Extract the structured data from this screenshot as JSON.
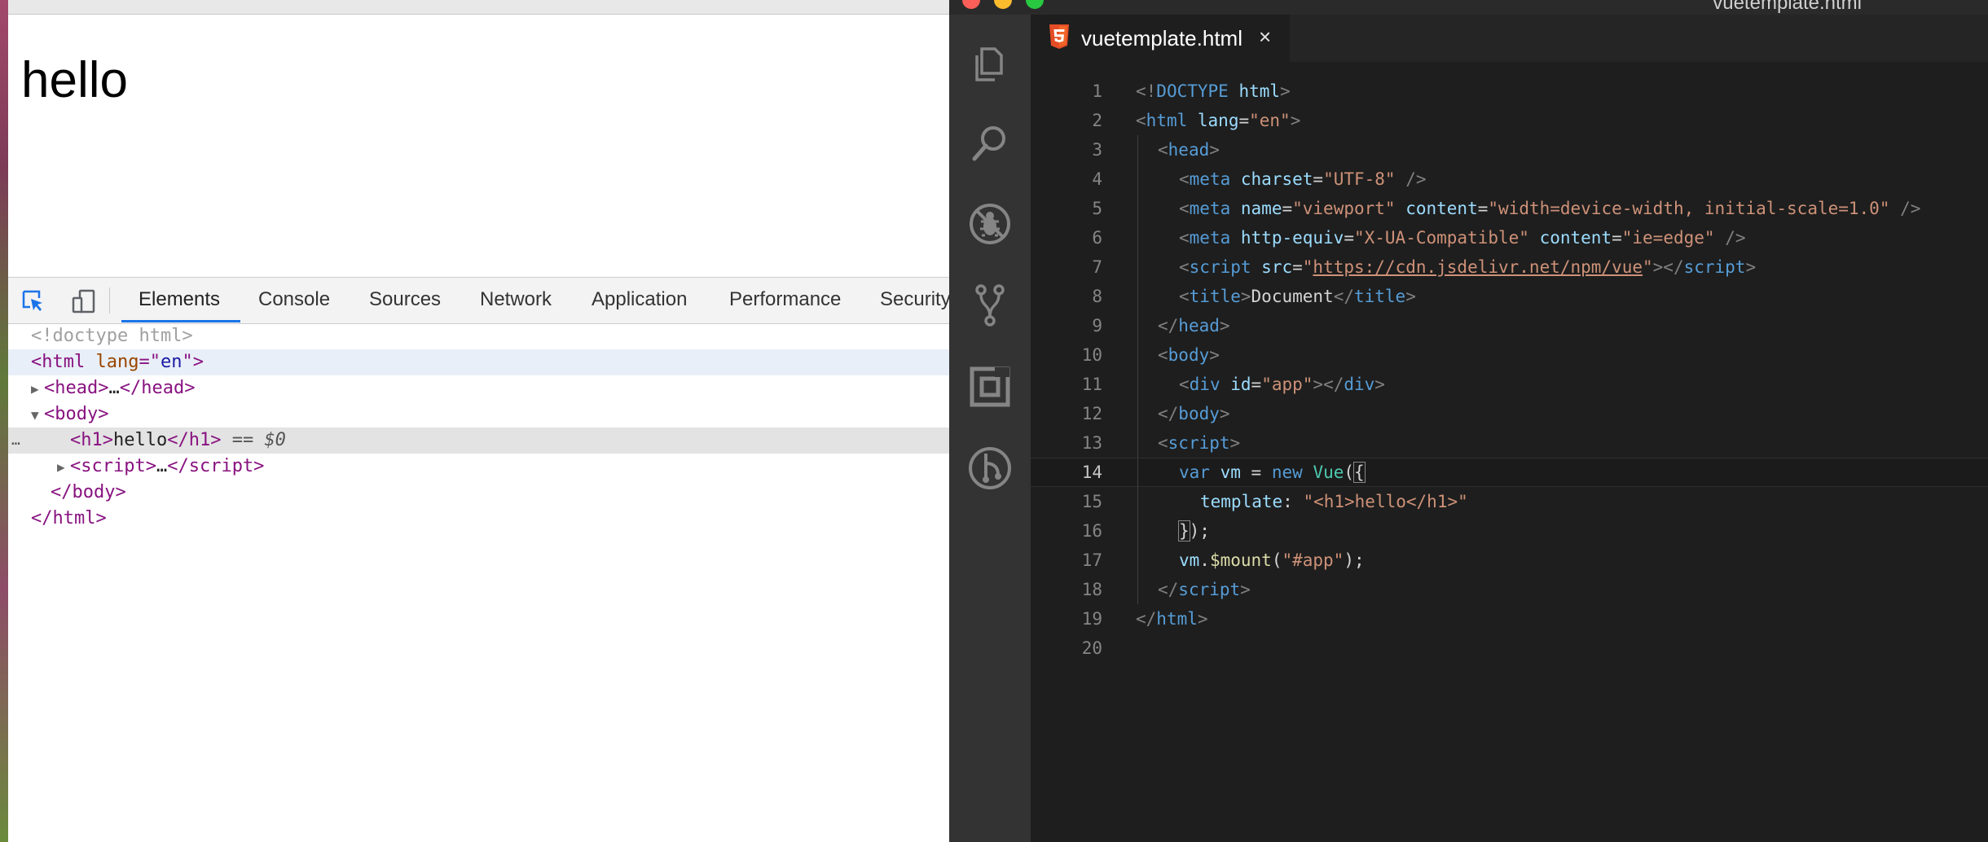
{
  "browser": {
    "page_heading": "hello"
  },
  "devtools": {
    "tabs": [
      "Elements",
      "Console",
      "Sources",
      "Network",
      "Application",
      "Performance",
      "Security"
    ],
    "active_tab": "Elements",
    "selected_ref": "== $0",
    "ellipsis": "…"
  },
  "editor": {
    "window_title": "vuetemplate.html",
    "tab_label": "vuetemplate.html",
    "tab_close": "×",
    "current_line": 14,
    "line_numbers": [
      "1",
      "2",
      "3",
      "4",
      "5",
      "6",
      "7",
      "8",
      "9",
      "10",
      "11",
      "12",
      "13",
      "14",
      "15",
      "16",
      "17",
      "18",
      "19",
      "20"
    ]
  },
  "colors": {
    "editor_bg": "#1e1e1e",
    "activity_bar": "#333333",
    "devtools_accent": "#1a73e8",
    "html5_orange": "#e44d26"
  },
  "icons": {
    "activity_bar": [
      "explorer-icon",
      "search-icon",
      "debug-icon",
      "source-control-icon",
      "extensions-icon",
      "git-history-icon"
    ],
    "devtools": [
      "inspect-element-icon",
      "device-toolbar-icon"
    ]
  }
}
